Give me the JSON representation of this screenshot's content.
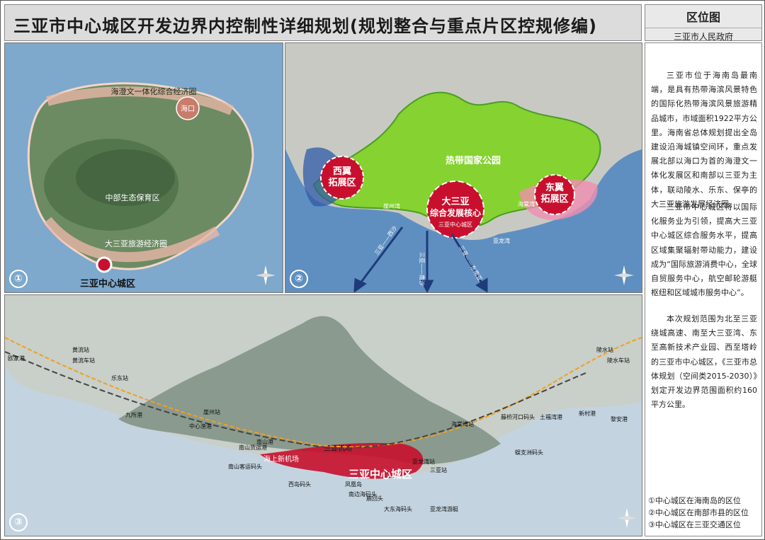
{
  "header": {
    "title": "三亚市中心城区开发边界内控制性详细规划(规划整合与重点片区控规修编)",
    "side_title": "区位图",
    "side_subtitle": "三亚市人民政府"
  },
  "panel1": {
    "number": "①",
    "label_haikou": "海口",
    "label_north": "海澄文一体化综合经济圈",
    "label_central": "中部生态保育区",
    "label_south": "大三亚旅游经济圈",
    "label_city": "三亚中心城区"
  },
  "panel2": {
    "number": "②",
    "park": "热带国家公园",
    "west": [
      "西翼",
      "拓展区"
    ],
    "east": [
      "东翼",
      "拓展区"
    ],
    "core": [
      "大三亚",
      "综合发展核心"
    ],
    "core_sub": "三亚中心城区",
    "route_a": "三亚——西沙",
    "route_b": "三亚——南沙",
    "route_c": "三亚——东南亚",
    "place_a": "崖州湾",
    "place_b": "海棠湾",
    "place_c": "亚龙湾"
  },
  "panel3": {
    "number": "③",
    "city": "三亚中心城区",
    "airport": "三亚机场",
    "new_airport": "海上新机场",
    "labels": [
      "乐东站",
      "黄流站",
      "九所港",
      "中心渔港",
      "崖州站",
      "南山货运港",
      "南山客运码头",
      "南山港",
      "西岛码头",
      "凤凰岛",
      "鹿回头",
      "南边海码头",
      "大东海码头",
      "亚龙湾站",
      "亚龙湾游艇",
      "三亚站",
      "海棠湾站",
      "藤桥河口码头",
      "土福湾港",
      "新村港",
      "黎安港",
      "蜈支洲码头",
      "陵水站",
      "陵水车站",
      "黄流车站",
      "欧家港"
    ]
  },
  "side": {
    "paragraphs": [
      "三亚市位于海南岛最南端，是具有热带海滨风景特色的国际化热带海滨风景旅游精品城市，市域面积1922平方公里。海南省总体规划提出全岛建设沿海城镇空间环，重点发展北部以海口为首的海澄文一体化发展区和南部以三亚为主体，联动陵水、乐东、保亭的大三亚旅游发展经济圈。",
      "三亚市中心城区将以国际化服务业为引领，提高大三亚中心城区综合服务水平，提高区域集聚辐射带动能力，建设成为“国际旅游消费中心，全球自贸服务中心，航空邮轮游艇枢纽和区域城市服务中心”。",
      "本次规划范围为北至三亚绕城高速、南至大三亚湾、东至高新技术产业园、西至塔岭的三亚市中心城区，《三亚市总体规划（空间类2015-2030）》划定开发边界范围面积约160平方公里。"
    ],
    "notes": [
      "①中心城区在海南岛的区位",
      "②中心城区在南部市县的区位",
      "③中心城区在三亚交通区位"
    ]
  },
  "colors": {
    "highlight_red": "#c8102e",
    "park_green": "#7ed321",
    "sea_blue": "#5f8fc1",
    "header_grey": "#dcdcdc"
  }
}
